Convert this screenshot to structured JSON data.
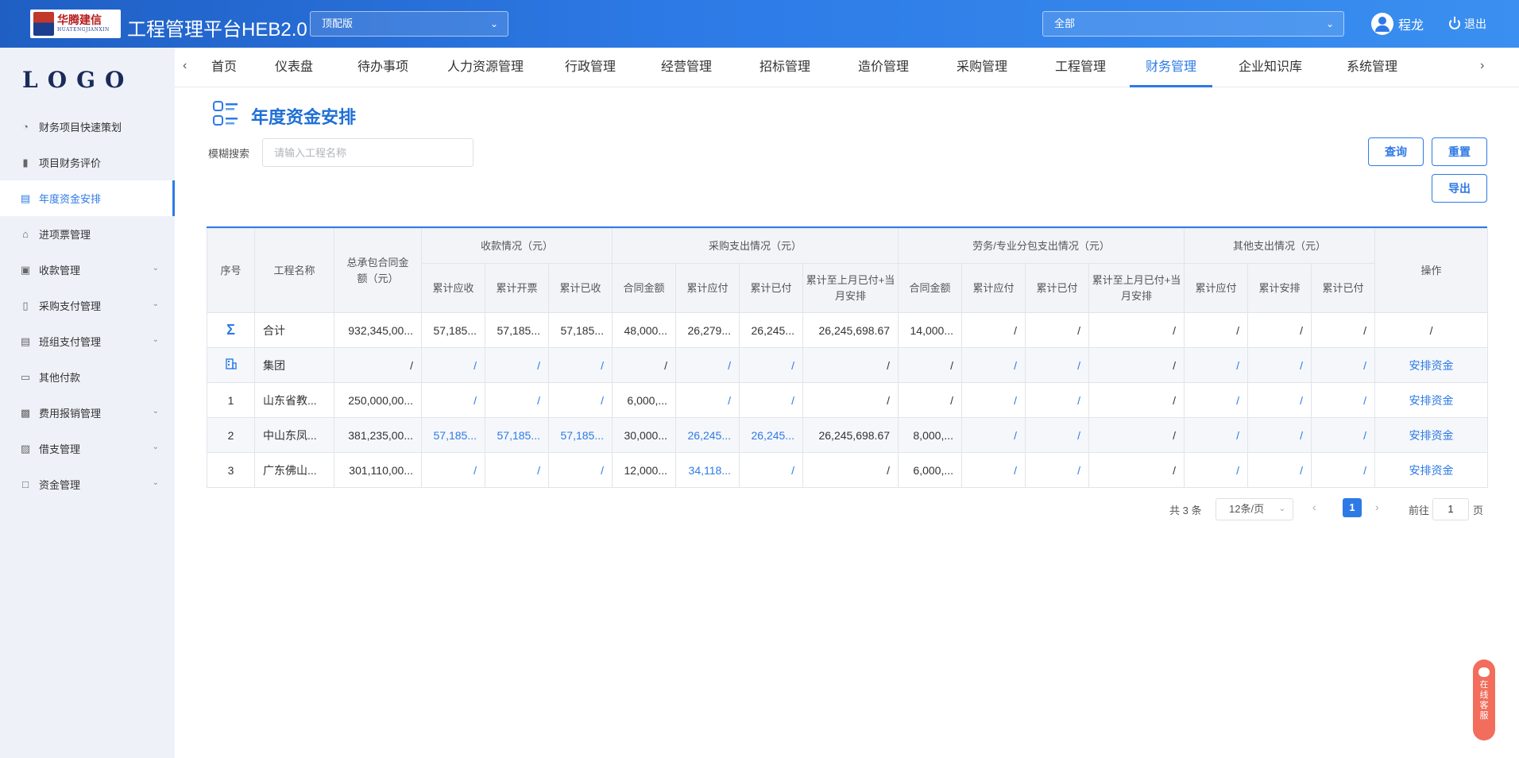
{
  "header": {
    "brand_cn": "华腾建信",
    "brand_en": "HUATENGJIANXIN",
    "app_title": "工程管理平台HEB2.0",
    "edition_select": "顶配版",
    "scope_select": "全部",
    "user_name": "程龙",
    "logout_label": "退出"
  },
  "sidebar": {
    "logo_text": "LOGO",
    "items": [
      {
        "label": "财务项目快速策划",
        "icon": "pie-chart-icon",
        "has_children": false
      },
      {
        "label": "项目财务评价",
        "icon": "bar-chart-icon",
        "has_children": false
      },
      {
        "label": "年度资金安排",
        "icon": "document-list-icon",
        "has_children": false,
        "active": true
      },
      {
        "label": "进项票管理",
        "icon": "home-icon",
        "has_children": false
      },
      {
        "label": "收款管理",
        "icon": "monitor-icon",
        "has_children": true
      },
      {
        "label": "采购支付管理",
        "icon": "bar-columns-icon",
        "has_children": true
      },
      {
        "label": "班组支付管理",
        "icon": "briefcase-icon",
        "has_children": true
      },
      {
        "label": "其他付款",
        "icon": "card-icon",
        "has_children": false
      },
      {
        "label": "费用报销管理",
        "icon": "receipt-icon",
        "has_children": true
      },
      {
        "label": "借支管理",
        "icon": "transfer-icon",
        "has_children": true
      },
      {
        "label": "资金管理",
        "icon": "folder-icon",
        "has_children": true
      }
    ]
  },
  "topnav": {
    "tabs": [
      "首页",
      "仪表盘",
      "待办事项",
      "人力资源管理",
      "行政管理",
      "经营管理",
      "招标管理",
      "造价管理",
      "采购管理",
      "工程管理",
      "财务管理",
      "企业知识库",
      "系统管理"
    ],
    "active_tab": "财务管理"
  },
  "page": {
    "title": "年度资金安排",
    "search_label": "模糊搜索",
    "search_placeholder": "请输入工程名称",
    "search_value": "",
    "query_button": "查询",
    "reset_button": "重置",
    "export_button": "导出"
  },
  "table": {
    "headers": {
      "index": "序号",
      "name": "工程名称",
      "contract_amount": "总承包合同金额（元）",
      "receipt_group": "收款情况（元）",
      "purchase_group": "采购支出情况（元）",
      "labor_group": "劳务/专业分包支出情况（元）",
      "other_group": "其他支出情况（元）",
      "operation": "操作",
      "receipt_cols": [
        "累计应收",
        "累计开票",
        "累计已收"
      ],
      "purchase_cols": [
        "合同金额",
        "累计应付",
        "累计已付",
        "累计至上月已付+当月安排"
      ],
      "labor_cols": [
        "合同金额",
        "累计应付",
        "累计已付",
        "累计至上月已付+当月安排"
      ],
      "other_cols": [
        "累计应付",
        "累计安排",
        "累计已付"
      ]
    },
    "rows": [
      {
        "index": "Σ",
        "index_icon": "sigma-icon",
        "name": "合计",
        "amount": "932,345,00...",
        "cells": [
          "57,185...",
          "57,185...",
          "57,185...",
          "48,000...",
          "26,279...",
          "26,245...",
          "26,245,698.67",
          "14,000...",
          "/",
          "/",
          "/",
          "/",
          "/",
          "/"
        ],
        "blue": [],
        "op": "/",
        "shaded": false
      },
      {
        "index": "",
        "index_icon": "building-icon",
        "name": "集团",
        "amount": "/",
        "cells": [
          "/",
          "/",
          "/",
          "/",
          "/",
          "/",
          "/",
          "/",
          "/",
          "/",
          "/",
          "/",
          "/",
          "/"
        ],
        "blue": [
          0,
          1,
          2,
          4,
          5,
          8,
          9,
          11,
          12,
          13
        ],
        "op": "安排资金",
        "shaded": true
      },
      {
        "index": "1",
        "index_icon": "",
        "name": "山东省教...",
        "amount": "250,000,00...",
        "cells": [
          "/",
          "/",
          "/",
          "6,000,...",
          "/",
          "/",
          "/",
          "/",
          "/",
          "/",
          "/",
          "/",
          "/",
          "/"
        ],
        "blue": [
          0,
          1,
          2,
          4,
          5,
          8,
          9,
          11,
          12,
          13
        ],
        "op": "安排资金",
        "shaded": false
      },
      {
        "index": "2",
        "index_icon": "",
        "name": "中山东凤...",
        "amount": "381,235,00...",
        "cells": [
          "57,185...",
          "57,185...",
          "57,185...",
          "30,000...",
          "26,245...",
          "26,245...",
          "26,245,698.67",
          "8,000,...",
          "/",
          "/",
          "/",
          "/",
          "/",
          "/"
        ],
        "blue": [
          0,
          1,
          2,
          4,
          5,
          8,
          9,
          11,
          12,
          13
        ],
        "op": "安排资金",
        "shaded": true
      },
      {
        "index": "3",
        "index_icon": "",
        "name": "广东佛山...",
        "amount": "301,110,00...",
        "cells": [
          "/",
          "/",
          "/",
          "12,000...",
          "34,118...",
          "/",
          "/",
          "6,000,...",
          "/",
          "/",
          "/",
          "/",
          "/",
          "/"
        ],
        "blue": [
          0,
          1,
          2,
          4,
          5,
          8,
          9,
          11,
          12,
          13
        ],
        "op": "安排资金",
        "shaded": false
      }
    ]
  },
  "pagination": {
    "total_text": "共 3 条",
    "page_size": "12条/页",
    "current_page": "1",
    "goto_label": "前往",
    "goto_value": "1",
    "unit": "页"
  },
  "float_service": {
    "label": "在线客服"
  },
  "colors": {
    "primary": "#2d7ae6",
    "header_start": "#1f5fc4",
    "sidebar_bg": "#eef1f8",
    "service": "#f26d5c"
  }
}
